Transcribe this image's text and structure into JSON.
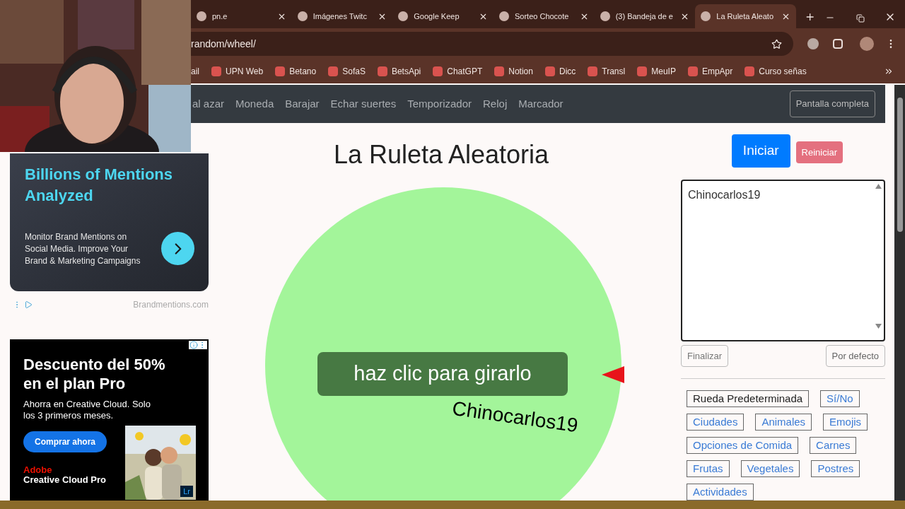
{
  "browser": {
    "tabs": [
      {
        "title": "pn.e",
        "selected": false
      },
      {
        "title": "Imágenes Twitc",
        "selected": false
      },
      {
        "title": "Google Keep",
        "selected": false
      },
      {
        "title": "Sorteo Chocote",
        "selected": false
      },
      {
        "title": "(3) Bandeja de e",
        "selected": false
      },
      {
        "title": "La Ruleta Aleato",
        "selected": true
      }
    ],
    "address": "random/wheel/",
    "bookmarks": [
      "ail",
      "UPN Web",
      "Betano",
      "SofaS",
      "BetsApi",
      "ChatGPT",
      "Notion",
      "Dicc",
      "Transl",
      "MeuIP",
      "EmpApr",
      "Curso señas"
    ]
  },
  "nav": {
    "links": [
      "al azar",
      "Moneda",
      "Barajar",
      "Echar suertes",
      "Temporizador",
      "Reloj",
      "Marcador"
    ],
    "fullscreen": "Pantalla completa"
  },
  "ads": [
    {
      "headline": "Billions of Mentions Analyzed",
      "body": "Monitor Brand Mentions on Social Media. Improve Your Brand & Marketing Campaigns",
      "source": "Brandmentions.com"
    },
    {
      "headline": "Descuento del 50% en el plan Pro",
      "body": "Ahorra en Creative Cloud. Solo los 3 primeros meses.",
      "cta": "Comprar ahora",
      "brand": "Adobe",
      "product": "Creative Cloud Pro",
      "badge": "Lr"
    }
  ],
  "title": "La Ruleta Aleatoria",
  "wheel": {
    "color": "#a3f59a",
    "hint": "haz clic para girarlo",
    "entry": "Chinocarlos19"
  },
  "controls": {
    "start": "Iniciar",
    "reset": "Reiniciar",
    "entries": "Chinocarlos19",
    "finish": "Finalizar",
    "default": "Por defecto"
  },
  "presets": [
    {
      "label": "Rueda Predeterminada",
      "selected": true
    },
    {
      "label": "Sí/No",
      "selected": false
    },
    {
      "label": "Ciudades",
      "selected": false
    },
    {
      "label": "Animales",
      "selected": false
    },
    {
      "label": "Emojis",
      "selected": false
    },
    {
      "label": "Opciones de Comida",
      "selected": false
    },
    {
      "label": "Carnes",
      "selected": false
    },
    {
      "label": "Frutas",
      "selected": false
    },
    {
      "label": "Vegetales",
      "selected": false
    },
    {
      "label": "Postres",
      "selected": false
    },
    {
      "label": "Actividades",
      "selected": false
    }
  ]
}
